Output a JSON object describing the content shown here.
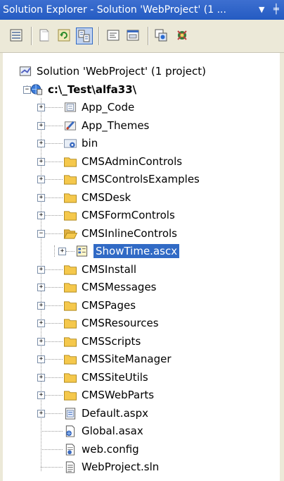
{
  "window": {
    "title": "Solution Explorer - Solution 'WebProject' (1 ...",
    "dropdown_glyph": "▼",
    "pin_glyph": "╪"
  },
  "toolbar": {
    "buttons": [
      {
        "icon": "properties-icon"
      },
      {
        "icon": "show-all-files-icon"
      },
      {
        "icon": "refresh-icon"
      },
      {
        "icon": "nest-related-files-icon",
        "active": true
      },
      {
        "icon": "view-code-icon"
      },
      {
        "icon": "view-designer-icon"
      },
      {
        "icon": "copy-website-icon"
      },
      {
        "icon": "asp-net-configuration-icon"
      }
    ]
  },
  "tree": {
    "solution": {
      "label": "Solution 'WebProject' (1 project)",
      "icon": "solution-icon"
    },
    "project": {
      "label": "c:\\_Test\\alfa33\\",
      "icon": "web-project-icon",
      "expander": "−"
    },
    "items": [
      {
        "label": "App_Code",
        "icon": "app-code-folder-icon",
        "expander": "+"
      },
      {
        "label": "App_Themes",
        "icon": "app-themes-folder-icon",
        "expander": "+"
      },
      {
        "label": "bin",
        "icon": "bin-folder-icon",
        "expander": "+"
      },
      {
        "label": "CMSAdminControls",
        "icon": "folder-icon",
        "expander": "+"
      },
      {
        "label": "CMSControlsExamples",
        "icon": "folder-icon",
        "expander": "+"
      },
      {
        "label": "CMSDesk",
        "icon": "folder-icon",
        "expander": "+"
      },
      {
        "label": "CMSFormControls",
        "icon": "folder-icon",
        "expander": "+"
      },
      {
        "label": "CMSInlineControls",
        "icon": "folder-open-icon",
        "expander": "−"
      },
      {
        "label": "ShowTime.ascx",
        "icon": "user-control-icon",
        "expander": "+",
        "child": true,
        "selected": true
      },
      {
        "label": "CMSInstall",
        "icon": "folder-icon",
        "expander": "+"
      },
      {
        "label": "CMSMessages",
        "icon": "folder-icon",
        "expander": "+"
      },
      {
        "label": "CMSPages",
        "icon": "folder-icon",
        "expander": "+"
      },
      {
        "label": "CMSResources",
        "icon": "folder-icon",
        "expander": "+"
      },
      {
        "label": "CMSScripts",
        "icon": "folder-icon",
        "expander": "+"
      },
      {
        "label": "CMSSiteManager",
        "icon": "folder-icon",
        "expander": "+"
      },
      {
        "label": "CMSSiteUtils",
        "icon": "folder-icon",
        "expander": "+"
      },
      {
        "label": "CMSWebParts",
        "icon": "folder-icon",
        "expander": "+"
      },
      {
        "label": "Default.aspx",
        "icon": "aspx-page-icon",
        "expander": "+"
      },
      {
        "label": "Global.asax",
        "icon": "global-asax-icon",
        "expander": ""
      },
      {
        "label": "web.config",
        "icon": "config-file-icon",
        "expander": ""
      },
      {
        "label": "WebProject.sln",
        "icon": "sln-file-icon",
        "expander": ""
      }
    ]
  },
  "colors": {
    "title_bar": "#245bc2",
    "selection": "#316ac5",
    "folder": "#f5c84c"
  }
}
